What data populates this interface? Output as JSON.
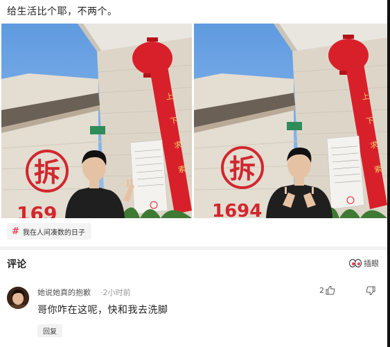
{
  "post": {
    "text": "给生活比个耶，不两个。",
    "photo_left_sign": "169",
    "photo_right_sign": "1694",
    "chai_char": "拆",
    "banner_text": "上下求索路行数十载"
  },
  "topic": {
    "hash_symbol": "#",
    "label": "我在人间凑数的日子"
  },
  "comments_section": {
    "title": "评论",
    "sort_label": "插眼",
    "sort_icon": "eyes-icon"
  },
  "comment": {
    "username": "她说她真的抱歉",
    "separator": "·",
    "time": "2小时前",
    "text": "哥你咋在这呢，快和我去洗脚",
    "reply_label": "回复",
    "like_count": "2"
  },
  "colors": {
    "accent": "#e8435a",
    "sky": "#7fb0e6",
    "banner_red": "#d8202a"
  }
}
